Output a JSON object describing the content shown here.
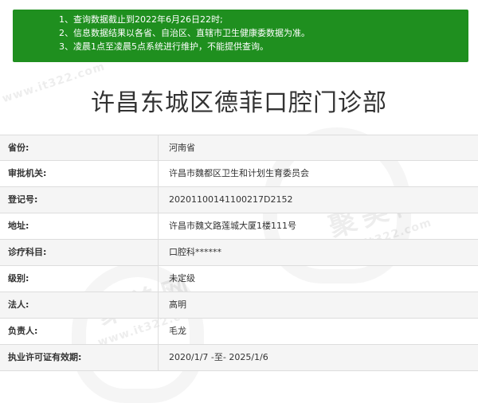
{
  "notice": {
    "lines": [
      "1、查询数据截止到2022年6月26日22时;",
      "2、信息数据结果以各省、自治区、直辖市卫生健康委数据为准。",
      "3、凌晨1点至凌晨5点系统进行维护，不能提供查询。"
    ],
    "background_color": "#1f8f1f"
  },
  "page_title": "许昌东城区德菲口腔门诊部",
  "info_rows": [
    {
      "label": "省份:",
      "value": "河南省"
    },
    {
      "label": "审批机关:",
      "value": "许昌市魏都区卫生和计划生育委员会"
    },
    {
      "label": "登记号:",
      "value": "20201100141100217D2152"
    },
    {
      "label": "地址:",
      "value": "许昌市魏文路莲城大厦1楼111号"
    },
    {
      "label": "诊疗科目:",
      "value": "口腔科******"
    },
    {
      "label": "级别:",
      "value": "未定级"
    },
    {
      "label": "法人:",
      "value": "高明"
    },
    {
      "label": "负责人:",
      "value": "毛龙"
    },
    {
      "label": "执业许可证有效期:",
      "value": "2020/1/7 -至- 2025/1/6"
    }
  ],
  "watermark": {
    "brand": "聚美网",
    "url": "www.it322.com"
  }
}
